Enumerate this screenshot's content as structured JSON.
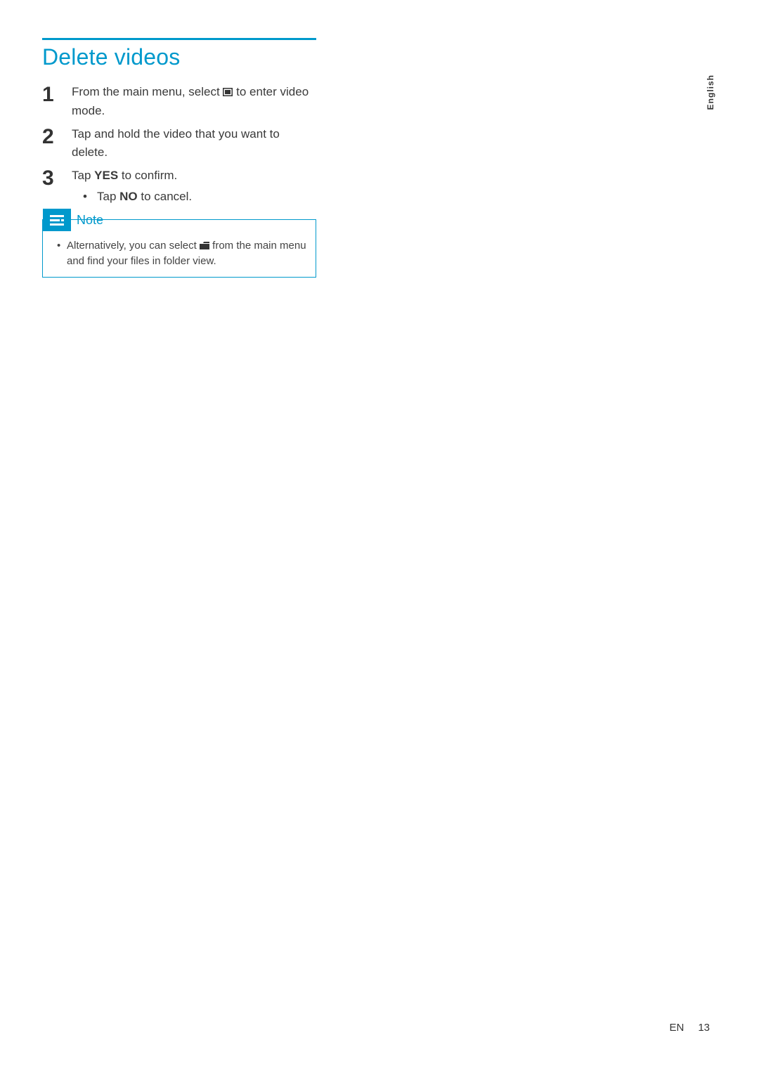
{
  "sideTab": "English",
  "title": "Delete videos",
  "steps": [
    {
      "pre": "From the main menu, select ",
      "iconName": "video-mode-icon",
      "post": " to enter video mode."
    },
    {
      "text": "Tap and hold the video that you want to delete."
    },
    {
      "pre": "Tap ",
      "bold1": "YES",
      "post1": " to confirm.",
      "sub": {
        "pre": "Tap ",
        "bold": "NO",
        "post": " to cancel."
      }
    }
  ],
  "note": {
    "label": "Note",
    "item": {
      "pre": "Alternatively, you can select ",
      "iconName": "folder-view-icon",
      "post": " from the main menu and find your files in folder view."
    }
  },
  "footer": {
    "lang": "EN",
    "page": "13"
  }
}
